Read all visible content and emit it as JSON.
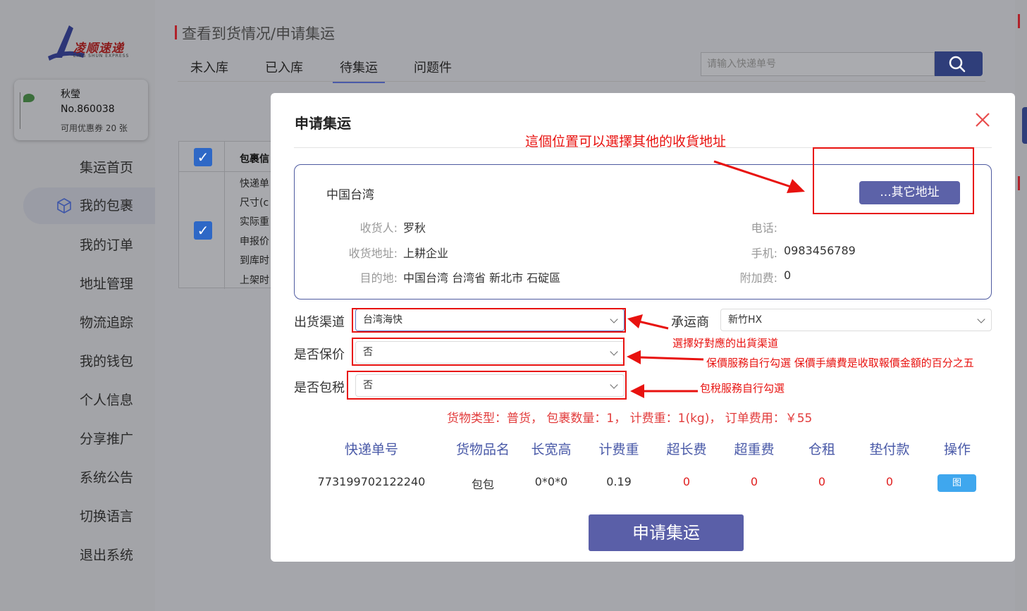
{
  "brand": {
    "logo_text": "凌顺速递",
    "logo_sub": "LING SHUN EXPRESS"
  },
  "user": {
    "name": "秋瑩",
    "number": "No.860038",
    "coupon": "可用优惠券 20 张"
  },
  "sidebar": {
    "items": [
      {
        "label": "集运首页"
      },
      {
        "label": "我的包裹"
      },
      {
        "label": "我的订单"
      },
      {
        "label": "地址管理"
      },
      {
        "label": "物流追踪"
      },
      {
        "label": "我的钱包"
      },
      {
        "label": "个人信息"
      },
      {
        "label": "分享推广"
      },
      {
        "label": "系统公告"
      },
      {
        "label": "切换语言"
      },
      {
        "label": "退出系统"
      }
    ],
    "active_index": 1
  },
  "page": {
    "title": "查看到货情况/申请集运",
    "tabs": [
      {
        "label": "未入库"
      },
      {
        "label": "已入库"
      },
      {
        "label": "待集运"
      },
      {
        "label": "问题件"
      }
    ],
    "active_tab": 2,
    "search_placeholder": "请输入快递单号"
  },
  "bg_table": {
    "header": "包裹信",
    "rows": [
      "快递单",
      "尺寸(c",
      "实际重",
      "申报价",
      "到库时",
      "上架时"
    ]
  },
  "modal": {
    "title": "申请集运",
    "address": {
      "country": "中国台湾",
      "other_button": "...其它地址",
      "receiver_label": "收货人:",
      "receiver": "罗秋",
      "address_label": "收货地址:",
      "address": "上耕企业",
      "destination_label": "目的地:",
      "destination": "中国台湾 台湾省 新北市 石碇區",
      "phone_label": "电话:",
      "phone": "",
      "mobile_label": "手机:",
      "mobile": "0983456789",
      "surcharge_label": "附加费:",
      "surcharge": "0"
    },
    "form": {
      "channel_label": "出货渠道",
      "channel_value": "台湾海快",
      "carrier_label": "承运商",
      "carrier_value": "新竹HX",
      "insure_label": "是否保价",
      "insure_value": "否",
      "tax_label": "是否包税",
      "tax_value": "否"
    },
    "summary": "货物类型：普货， 包裹数量：1， 计费重：1(kg)， 订单费用：￥55",
    "table": {
      "headers": [
        "快递单号",
        "货物品名",
        "长宽高",
        "计费重",
        "超长费",
        "超重费",
        "仓租",
        "垫付款",
        "操作"
      ],
      "row": [
        "773199702122240",
        "包包",
        "0*0*0",
        "0.19",
        "0",
        "0",
        "0",
        "0"
      ],
      "action_label": "图"
    },
    "apply_button": "申请集运"
  },
  "annotations": {
    "other_address_note": "這個位置可以選擇其他的收貨地址",
    "channel_note": "選擇好對應的出貨渠道",
    "insure_note": "保價服務自行勾選  保價手續費是收取報價金額的百分之五",
    "tax_note": "包稅服務自行勾選"
  },
  "colors": {
    "accent": "#5a5fa8",
    "annotation": "#e8120f",
    "link_blue": "#3fa7ee",
    "brand_red": "#b0222a"
  }
}
